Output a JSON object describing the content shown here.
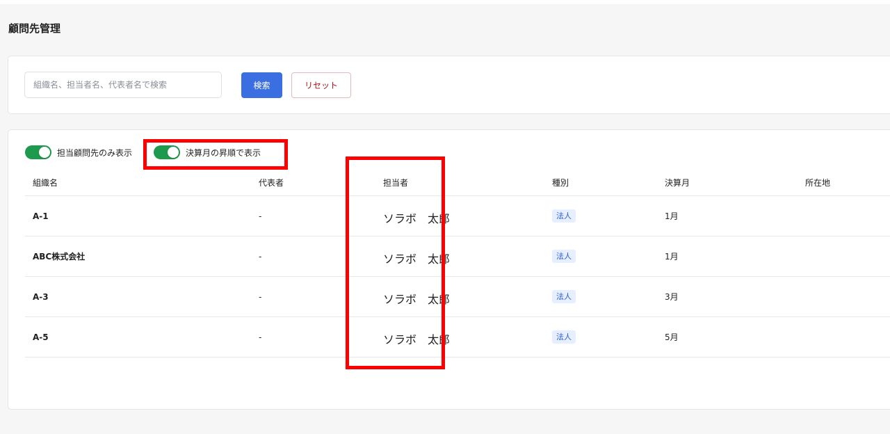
{
  "page": {
    "title": "顧問先管理"
  },
  "search": {
    "placeholder": "組織名、担当者名、代表者名で検索",
    "value": "",
    "search_label": "検索",
    "reset_label": "リセット"
  },
  "filters": {
    "assigned_only": {
      "label": "担当顧問先のみ表示",
      "enabled": true
    },
    "sort_by_month": {
      "label": "決算月の昇順で表示",
      "enabled": true
    }
  },
  "table": {
    "headers": {
      "org": "組織名",
      "representative": "代表者",
      "person": "担当者",
      "type": "種別",
      "month": "決算月",
      "address": "所在地"
    },
    "rows": [
      {
        "org": "A-1",
        "representative": "-",
        "person": "ソラボ　太郎",
        "type": "法人",
        "month": "1月",
        "address": ""
      },
      {
        "org": "ABC株式会社",
        "representative": "-",
        "person": "ソラボ　太郎",
        "type": "法人",
        "month": "1月",
        "address": ""
      },
      {
        "org": "A-3",
        "representative": "-",
        "person": "ソラボ　太郎",
        "type": "法人",
        "month": "3月",
        "address": ""
      },
      {
        "org": "A-5",
        "representative": "-",
        "person": "ソラボ　太郎",
        "type": "法人",
        "month": "5月",
        "address": ""
      }
    ]
  },
  "colors": {
    "primary": "#3b6fe1",
    "danger_text": "#a8141c",
    "toggle_on": "#1d9a4d",
    "badge_bg": "#e6efff",
    "badge_text": "#2c5ccf",
    "highlight": "#ff0000"
  }
}
